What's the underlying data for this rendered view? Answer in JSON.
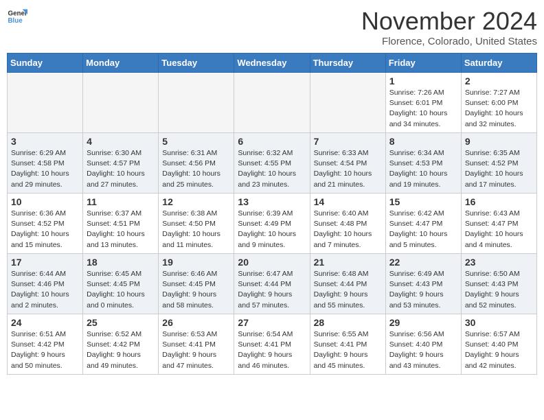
{
  "header": {
    "logo": {
      "text_general": "General",
      "text_blue": "Blue"
    },
    "title": "November 2024",
    "location": "Florence, Colorado, United States"
  },
  "weekdays": [
    "Sunday",
    "Monday",
    "Tuesday",
    "Wednesday",
    "Thursday",
    "Friday",
    "Saturday"
  ],
  "weeks": [
    [
      {
        "day": "",
        "detail": ""
      },
      {
        "day": "",
        "detail": ""
      },
      {
        "day": "",
        "detail": ""
      },
      {
        "day": "",
        "detail": ""
      },
      {
        "day": "",
        "detail": ""
      },
      {
        "day": "1",
        "detail": "Sunrise: 7:26 AM\nSunset: 6:01 PM\nDaylight: 10 hours\nand 34 minutes."
      },
      {
        "day": "2",
        "detail": "Sunrise: 7:27 AM\nSunset: 6:00 PM\nDaylight: 10 hours\nand 32 minutes."
      }
    ],
    [
      {
        "day": "3",
        "detail": "Sunrise: 6:29 AM\nSunset: 4:58 PM\nDaylight: 10 hours\nand 29 minutes."
      },
      {
        "day": "4",
        "detail": "Sunrise: 6:30 AM\nSunset: 4:57 PM\nDaylight: 10 hours\nand 27 minutes."
      },
      {
        "day": "5",
        "detail": "Sunrise: 6:31 AM\nSunset: 4:56 PM\nDaylight: 10 hours\nand 25 minutes."
      },
      {
        "day": "6",
        "detail": "Sunrise: 6:32 AM\nSunset: 4:55 PM\nDaylight: 10 hours\nand 23 minutes."
      },
      {
        "day": "7",
        "detail": "Sunrise: 6:33 AM\nSunset: 4:54 PM\nDaylight: 10 hours\nand 21 minutes."
      },
      {
        "day": "8",
        "detail": "Sunrise: 6:34 AM\nSunset: 4:53 PM\nDaylight: 10 hours\nand 19 minutes."
      },
      {
        "day": "9",
        "detail": "Sunrise: 6:35 AM\nSunset: 4:52 PM\nDaylight: 10 hours\nand 17 minutes."
      }
    ],
    [
      {
        "day": "10",
        "detail": "Sunrise: 6:36 AM\nSunset: 4:52 PM\nDaylight: 10 hours\nand 15 minutes."
      },
      {
        "day": "11",
        "detail": "Sunrise: 6:37 AM\nSunset: 4:51 PM\nDaylight: 10 hours\nand 13 minutes."
      },
      {
        "day": "12",
        "detail": "Sunrise: 6:38 AM\nSunset: 4:50 PM\nDaylight: 10 hours\nand 11 minutes."
      },
      {
        "day": "13",
        "detail": "Sunrise: 6:39 AM\nSunset: 4:49 PM\nDaylight: 10 hours\nand 9 minutes."
      },
      {
        "day": "14",
        "detail": "Sunrise: 6:40 AM\nSunset: 4:48 PM\nDaylight: 10 hours\nand 7 minutes."
      },
      {
        "day": "15",
        "detail": "Sunrise: 6:42 AM\nSunset: 4:47 PM\nDaylight: 10 hours\nand 5 minutes."
      },
      {
        "day": "16",
        "detail": "Sunrise: 6:43 AM\nSunset: 4:47 PM\nDaylight: 10 hours\nand 4 minutes."
      }
    ],
    [
      {
        "day": "17",
        "detail": "Sunrise: 6:44 AM\nSunset: 4:46 PM\nDaylight: 10 hours\nand 2 minutes."
      },
      {
        "day": "18",
        "detail": "Sunrise: 6:45 AM\nSunset: 4:45 PM\nDaylight: 10 hours\nand 0 minutes."
      },
      {
        "day": "19",
        "detail": "Sunrise: 6:46 AM\nSunset: 4:45 PM\nDaylight: 9 hours\nand 58 minutes."
      },
      {
        "day": "20",
        "detail": "Sunrise: 6:47 AM\nSunset: 4:44 PM\nDaylight: 9 hours\nand 57 minutes."
      },
      {
        "day": "21",
        "detail": "Sunrise: 6:48 AM\nSunset: 4:44 PM\nDaylight: 9 hours\nand 55 minutes."
      },
      {
        "day": "22",
        "detail": "Sunrise: 6:49 AM\nSunset: 4:43 PM\nDaylight: 9 hours\nand 53 minutes."
      },
      {
        "day": "23",
        "detail": "Sunrise: 6:50 AM\nSunset: 4:43 PM\nDaylight: 9 hours\nand 52 minutes."
      }
    ],
    [
      {
        "day": "24",
        "detail": "Sunrise: 6:51 AM\nSunset: 4:42 PM\nDaylight: 9 hours\nand 50 minutes."
      },
      {
        "day": "25",
        "detail": "Sunrise: 6:52 AM\nSunset: 4:42 PM\nDaylight: 9 hours\nand 49 minutes."
      },
      {
        "day": "26",
        "detail": "Sunrise: 6:53 AM\nSunset: 4:41 PM\nDaylight: 9 hours\nand 47 minutes."
      },
      {
        "day": "27",
        "detail": "Sunrise: 6:54 AM\nSunset: 4:41 PM\nDaylight: 9 hours\nand 46 minutes."
      },
      {
        "day": "28",
        "detail": "Sunrise: 6:55 AM\nSunset: 4:41 PM\nDaylight: 9 hours\nand 45 minutes."
      },
      {
        "day": "29",
        "detail": "Sunrise: 6:56 AM\nSunset: 4:40 PM\nDaylight: 9 hours\nand 43 minutes."
      },
      {
        "day": "30",
        "detail": "Sunrise: 6:57 AM\nSunset: 4:40 PM\nDaylight: 9 hours\nand 42 minutes."
      }
    ]
  ]
}
